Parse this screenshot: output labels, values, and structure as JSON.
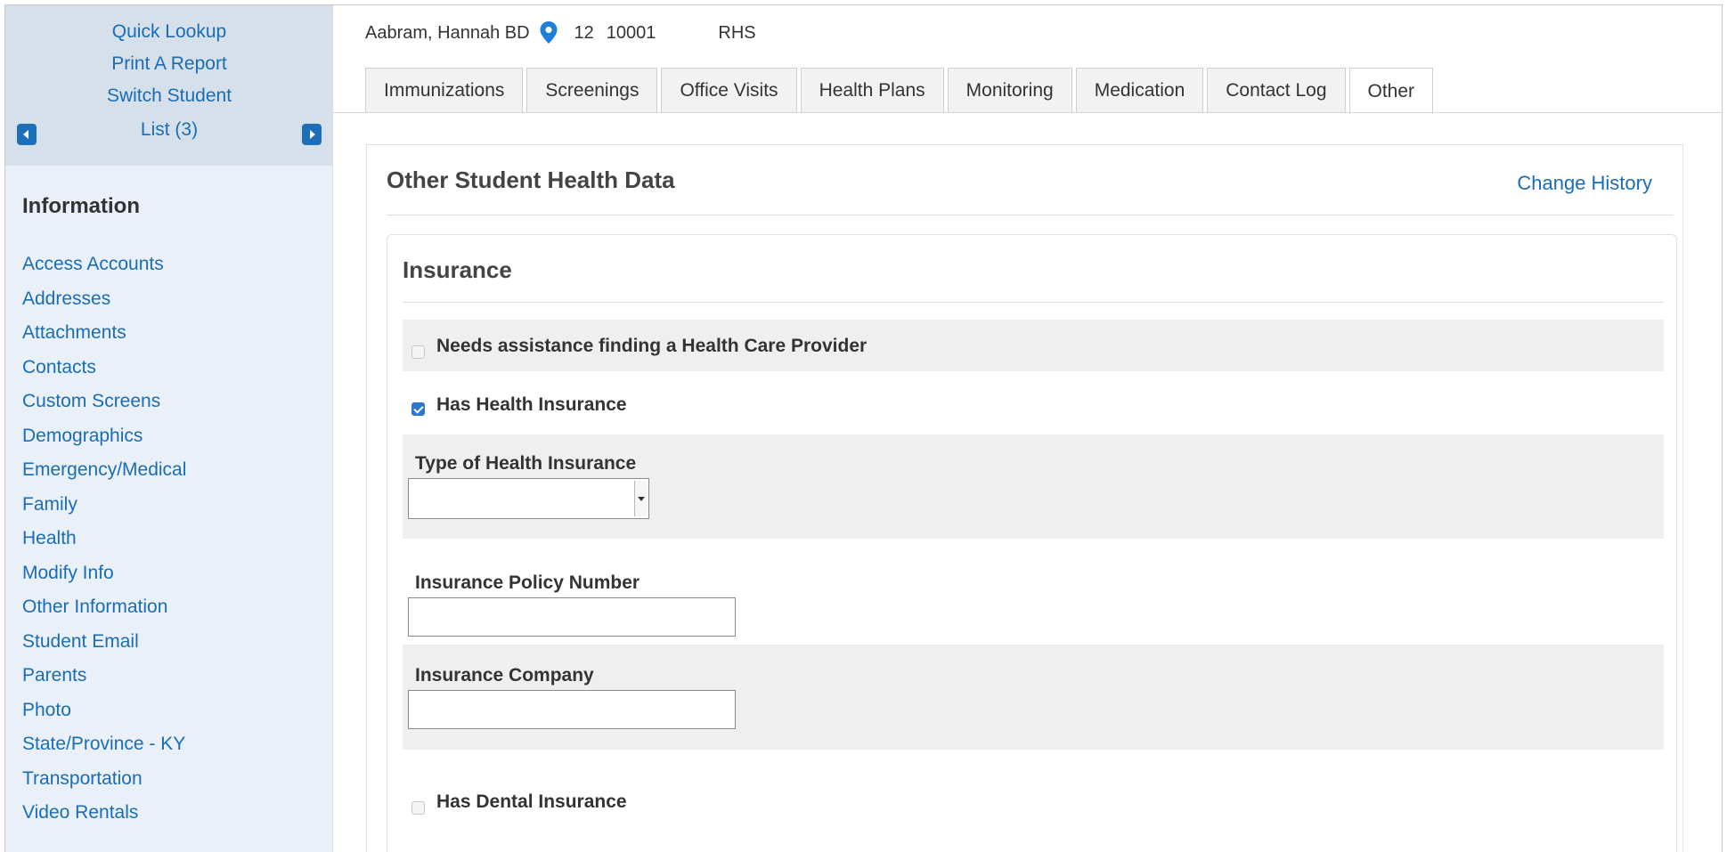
{
  "sidebar": {
    "top_links": [
      "Quick Lookup",
      "Print A Report",
      "Switch Student",
      "List (3)"
    ],
    "heading": "Information",
    "items": [
      "Access Accounts",
      "Addresses",
      "Attachments",
      "Contacts",
      "Custom Screens",
      "Demographics",
      "Emergency/Medical",
      "Family",
      "Health",
      "Modify Info",
      "Other Information",
      "Student Email",
      "Parents",
      "Photo",
      "State/Province - KY",
      "Transportation",
      "Video Rentals"
    ]
  },
  "student": {
    "name": "Aabram, Hannah BD",
    "grade": "12",
    "id": "10001",
    "school": "RHS"
  },
  "tabs": [
    {
      "label": "Immunizations",
      "active": false
    },
    {
      "label": "Screenings",
      "active": false
    },
    {
      "label": "Office Visits",
      "active": false
    },
    {
      "label": "Health Plans",
      "active": false
    },
    {
      "label": "Monitoring",
      "active": false
    },
    {
      "label": "Medication",
      "active": false
    },
    {
      "label": "Contact Log",
      "active": false
    },
    {
      "label": "Other",
      "active": true
    }
  ],
  "panel": {
    "title": "Other Student Health Data",
    "change_history": "Change History"
  },
  "insurance": {
    "title": "Insurance",
    "needs_assistance": {
      "label": "Needs assistance finding a Health Care Provider",
      "checked": false
    },
    "has_health_insurance": {
      "label": "Has Health Insurance",
      "checked": true
    },
    "type_label": "Type of Health Insurance",
    "type_value": "",
    "policy_label": "Insurance Policy Number",
    "policy_value": "",
    "company_label": "Insurance Company",
    "company_value": "",
    "has_dental_insurance": {
      "label": "Has Dental Insurance",
      "checked": false
    }
  },
  "colors": {
    "link": "#1a6db5",
    "sidebar_bg": "#eaf0f7",
    "checkbox_checked": "#2f78c8"
  }
}
